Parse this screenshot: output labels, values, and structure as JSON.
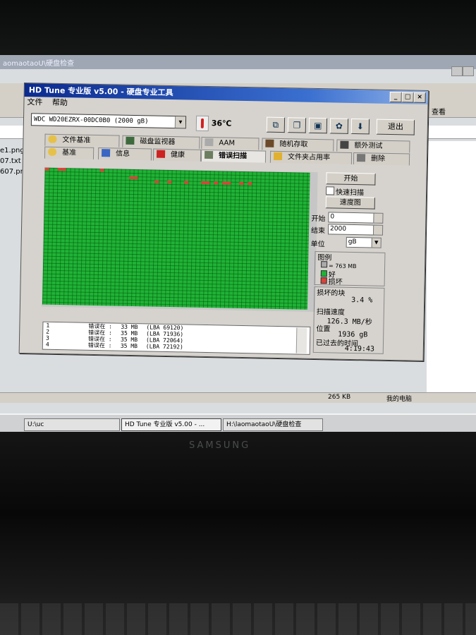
{
  "monitor_brand": "SAMSUNG",
  "background_window": {
    "title": "aomaotaoU\\硬盘检查",
    "files": [
      "e1.png",
      "07.txt",
      "607.png"
    ],
    "status_size": "265 KB",
    "status_location": "我的电脑",
    "toolbar_right_label": "查看"
  },
  "taskbar": {
    "items": [
      "U:\\uc",
      "HD Tune 专业版 v5.00 - ...",
      "H:\\laomaotaoU\\硬盘检查"
    ]
  },
  "app": {
    "title": "HD Tune 专业版 v5.00 - 硬盘专业工具",
    "menu": [
      "文件",
      "帮助"
    ],
    "drive": "WDC WD20EZRX-00DC0B0 (2000 gB)",
    "temperature": "36℃",
    "exit_label": "退出",
    "tabs_row1": [
      "文件基准",
      "磁盘监视器",
      "AAM",
      "随机存取",
      "额外测试"
    ],
    "tabs_row2": [
      "基准",
      "信息",
      "健康",
      "错误扫描",
      "文件夹占用率",
      "删除"
    ],
    "active_tab": "错误扫描"
  },
  "scan": {
    "start_label": "开始",
    "quick_scan_label": "快速扫描",
    "quick_scan_checked": false,
    "map_label": "速度图",
    "start_field_label": "开始",
    "start_value": "0",
    "end_field_label": "结束",
    "end_value": "2000",
    "unit_label": "单位",
    "unit_value": "gB",
    "legend_title": "图例",
    "legend_block": "= 763 MB",
    "legend_ok": "好",
    "legend_bad": "损坏",
    "damaged_label": "损坏的块",
    "damaged_value": "3.4 %",
    "speed_label": "扫描速度",
    "speed_value": "126.3 MB/秒",
    "position_label": "位置",
    "position_value": "1936 gB",
    "elapsed_label": "已过去的时间",
    "elapsed_value": "4:19:43"
  },
  "log": [
    {
      "no": "1",
      "text": "错误在 :",
      "size": "33 MB",
      "lba": "(LBA 69120)"
    },
    {
      "no": "2",
      "text": "错误在 :",
      "size": "35 MB",
      "lba": "(LBA 71936)"
    },
    {
      "no": "3",
      "text": "错误在 :",
      "size": "35 MB",
      "lba": "(LBA 72064)"
    },
    {
      "no": "4",
      "text": "错误在 :",
      "size": "35 MB",
      "lba": "(LBA 72192)"
    }
  ],
  "colors": {
    "block_good": "#1fb336",
    "block_bad": "#d8443a",
    "titlebar": "#0b2a8e"
  }
}
